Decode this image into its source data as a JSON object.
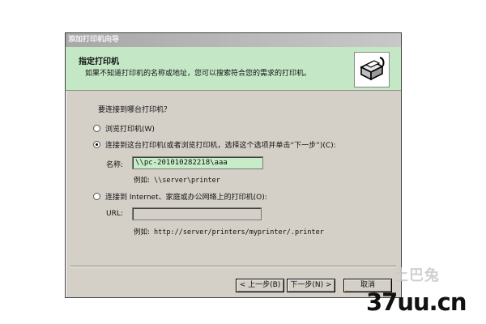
{
  "window": {
    "title": "添加打印机向导"
  },
  "header": {
    "title": "指定打印机",
    "subtitle": "如果不知道打印机的名称或地址，您可以搜索符合您的需求的打印机。",
    "icon": "printer-icon"
  },
  "body": {
    "question": "要连接到哪台打印机？",
    "options": [
      {
        "label": "浏览打印机(W)",
        "checked": false
      },
      {
        "label": "连接到这台打印机(或者浏览打印机，选择这个选项并单击“下一步”)(C):",
        "checked": true
      },
      {
        "label": "连接到 Internet、家庭或办公网络上的打印机(O):",
        "checked": false
      }
    ],
    "name_label": "名称:",
    "name_value": "\\\\pc-201010282218\\aaa",
    "name_example_prefix": "例如:",
    "name_example": "\\\\server\\printer",
    "url_label": "URL:",
    "url_value": "",
    "url_example_prefix": "例如:",
    "url_example": "http://server/printers/myprinter/.printer"
  },
  "buttons": {
    "back": "< 上一步(B)",
    "next": "下一步(N) >",
    "cancel": "取消"
  },
  "watermark": {
    "cn": "土巴兔",
    "site": "37uu.cn"
  }
}
